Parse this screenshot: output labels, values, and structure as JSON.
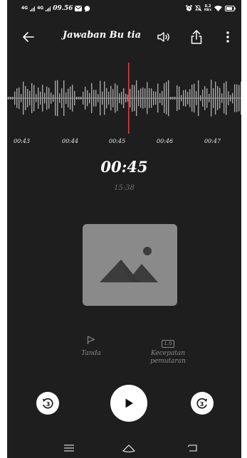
{
  "status_bar": {
    "network_1": "4G",
    "network_2": "4G",
    "time": "09.56",
    "speed_value": "0.2",
    "speed_unit": "KB/s"
  },
  "header": {
    "title": "Jawaban Bu tia"
  },
  "timeline": {
    "ticks": [
      "00:43",
      "00:44",
      "00:45",
      "00:46",
      "00:47"
    ]
  },
  "playback": {
    "current_time": "00:45",
    "total_time": "15:38",
    "skip_back_seconds": "3",
    "skip_forward_seconds": "3"
  },
  "actions": {
    "mark_label": "Tanda",
    "speed_label_line1": "Kecepatan",
    "speed_label_line2": "pemutaran",
    "speed_value": "1.0"
  },
  "colors": {
    "background": "#1e1e1e",
    "playhead": "#e0393e",
    "waveform": "#a8a8a8",
    "muted_text": "#8c8c8c"
  }
}
